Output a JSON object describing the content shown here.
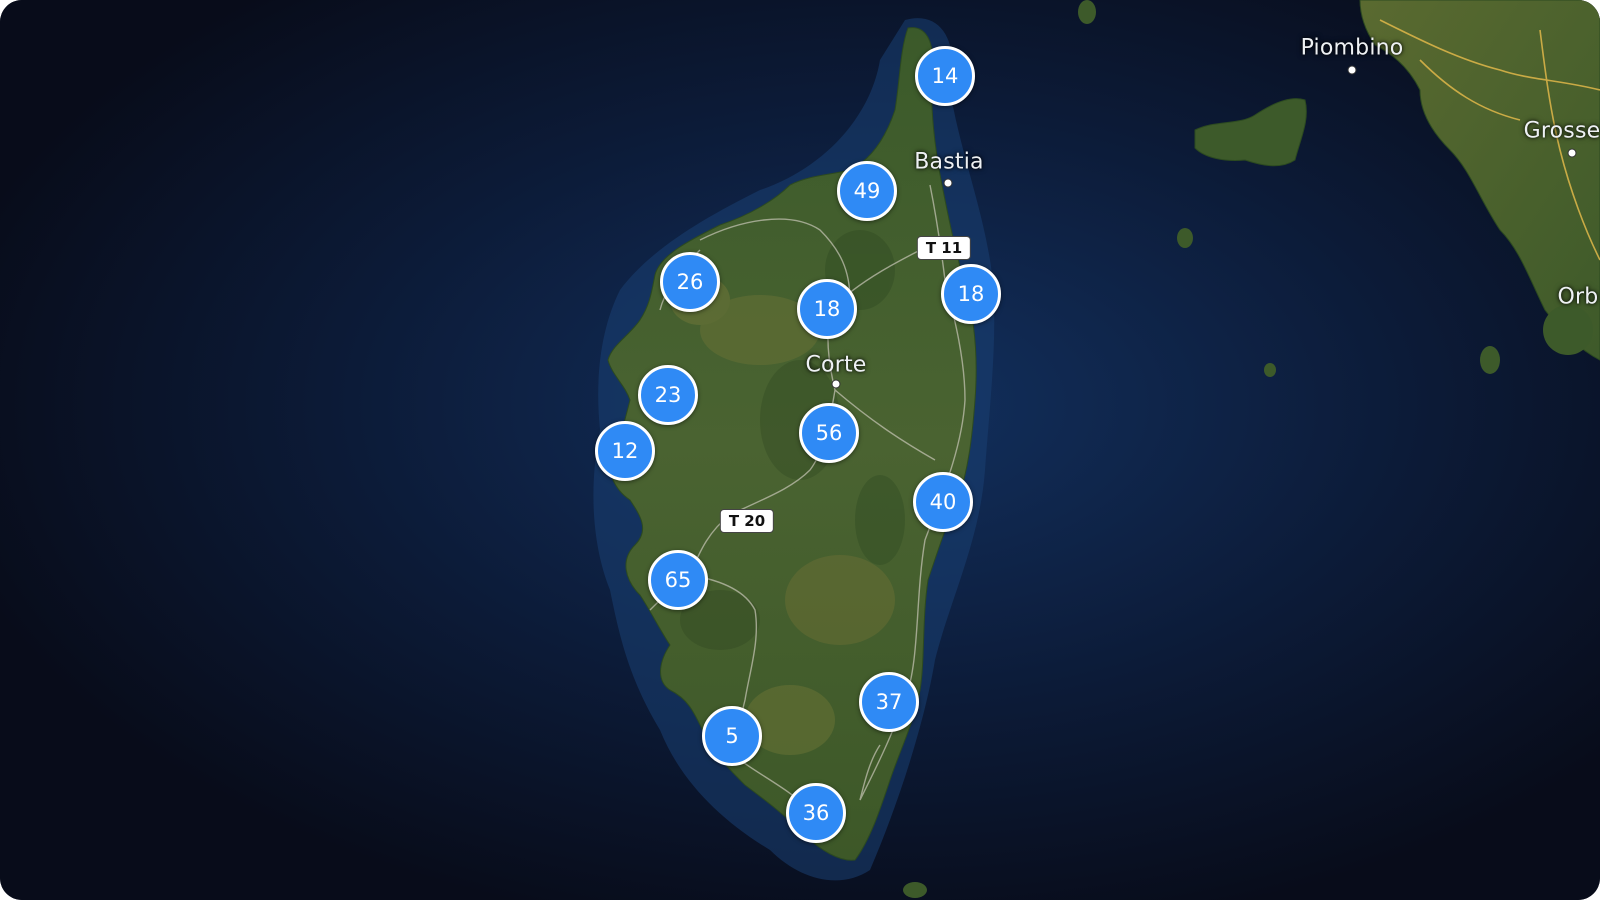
{
  "map": {
    "colors": {
      "sea": "#0a0f1e",
      "land": "#3f5a2a",
      "cluster_fill": "#2f8af5",
      "cluster_border": "#ffffff"
    },
    "places": [
      {
        "name": "Bastia"
      },
      {
        "name": "Corte"
      },
      {
        "name": "Piombino"
      },
      {
        "name": "Grosse"
      },
      {
        "name": "Orb"
      }
    ],
    "roads": [
      {
        "label": "T 11"
      },
      {
        "label": "T 20"
      }
    ],
    "clusters": [
      {
        "count": "14"
      },
      {
        "count": "49"
      },
      {
        "count": "26"
      },
      {
        "count": "18"
      },
      {
        "count": "18"
      },
      {
        "count": "23"
      },
      {
        "count": "12"
      },
      {
        "count": "56"
      },
      {
        "count": "40"
      },
      {
        "count": "65"
      },
      {
        "count": "37"
      },
      {
        "count": "5"
      },
      {
        "count": "36"
      }
    ]
  }
}
